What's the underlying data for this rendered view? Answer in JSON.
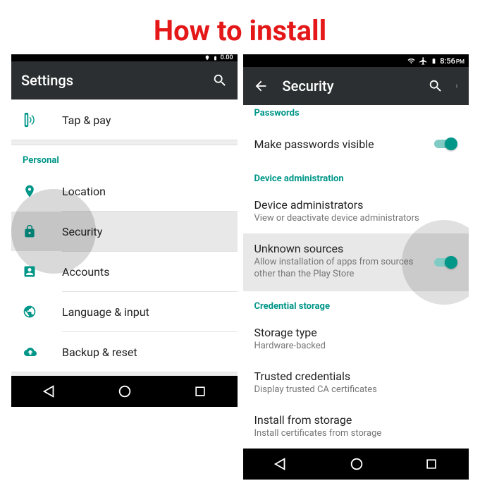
{
  "heading": "How to install",
  "status": {
    "time": "8:56",
    "pm": "PM",
    "time_partial": "0.00"
  },
  "left": {
    "appbar_title": "Settings",
    "item_tap_pay": "Tap & pay",
    "section_personal": "Personal",
    "item_location": "Location",
    "item_security": "Security",
    "item_accounts": "Accounts",
    "item_language": "Language & input",
    "item_backup": "Backup & reset"
  },
  "right": {
    "appbar_title": "Security",
    "section_passwords": "Passwords",
    "passwords_visible": "Make passwords visible",
    "section_device_admin": "Device administration",
    "device_admins": "Device administrators",
    "device_admins_sub": "View or deactivate device administrators",
    "unknown_sources": "Unknown sources",
    "unknown_sources_sub": "Allow installation of apps from sources other than the Play Store",
    "section_credential": "Credential storage",
    "storage_type": "Storage type",
    "storage_type_sub": "Hardware-backed",
    "trusted_creds": "Trusted credentials",
    "trusted_creds_sub": "Display trusted CA certificates",
    "install_storage": "Install from storage",
    "install_storage_sub": "Install certificates from storage"
  }
}
